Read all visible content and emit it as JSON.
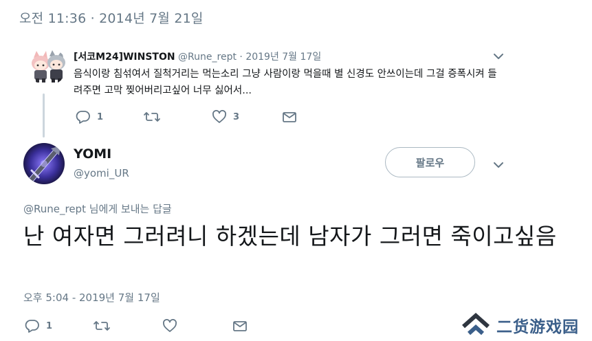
{
  "header": {
    "timestamp": "오전 11:36 · 2014년 7월 21일"
  },
  "parent_tweet": {
    "display_name": "[서코M24]WINSTON",
    "handle": "@Rune_rept",
    "separator": "·",
    "date": "2019년 7월 17일",
    "text": "음식이랑 침섞여서 질척거리는 먹는소리 그냥 사람이랑 먹을때 별 신경도 안쓰이는데 그걸 증폭시켜 들려주면 고막 찢어버리고싶어 너무 싫어서...",
    "reply_count": "1",
    "retweet_count": "",
    "like_count": "3",
    "icons": [
      "reply-icon",
      "retweet-icon",
      "like-icon",
      "message-icon",
      "chevron-down-icon"
    ]
  },
  "main_tweet": {
    "display_name": "YOMI",
    "handle": "@yomi_UR",
    "follow_label": "팔로우",
    "reply_to_handle": "@Rune_rept",
    "reply_to_suffix": " 님에게 보내는 답글",
    "text": "난 여자면 그러려니 하겠는데 남자가 그러면 죽이고싶음",
    "timestamp": "오후 5:04 - 2019년 7월 17일",
    "reply_count": "1",
    "retweet_count": "",
    "like_count": "",
    "icons": [
      "reply-icon",
      "retweet-icon",
      "like-icon",
      "message-icon",
      "chevron-down-icon"
    ]
  },
  "watermark": {
    "text": "二货游戏园",
    "icon": "double-chevron-logo"
  },
  "colors": {
    "text": "#14171a",
    "secondary": "#657786",
    "border": "#aab8c2",
    "watermark": "#3b5f8a"
  }
}
